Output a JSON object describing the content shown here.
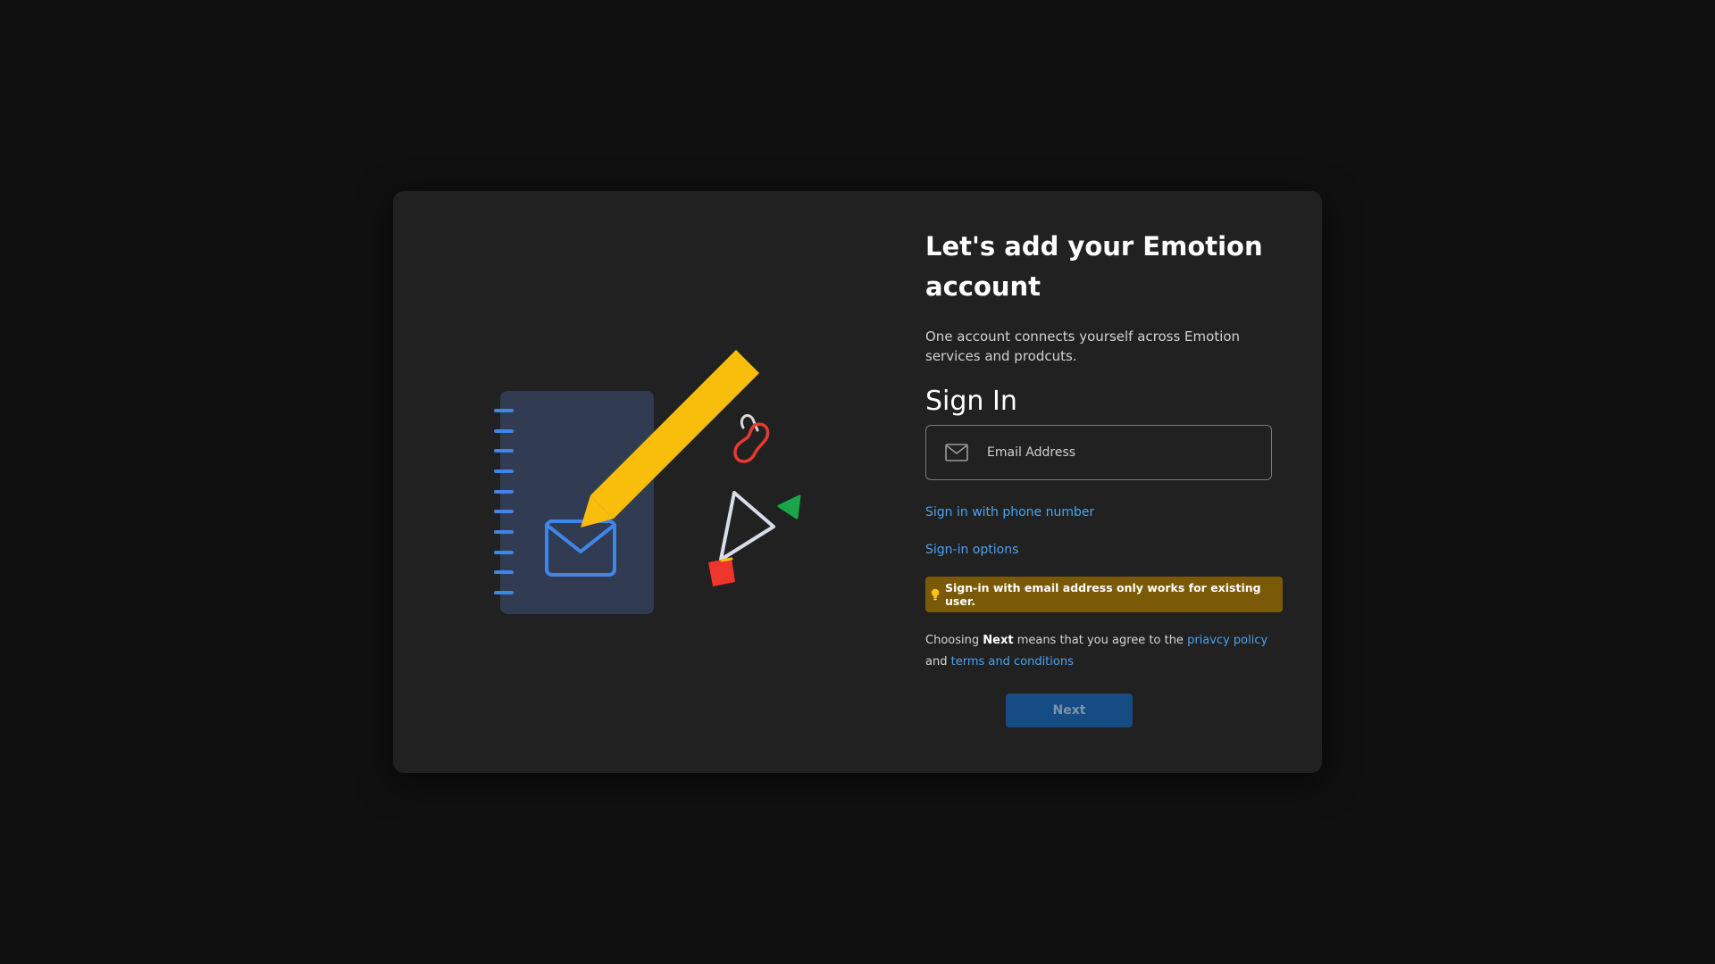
{
  "colors": {
    "background": "#101010",
    "dialog": "#212121",
    "link": "#4ba3f0",
    "notice_bg": "#7a5a06",
    "next_button_bg": "#164c84",
    "pencil": "#f9bd0b",
    "notebook": "#313b52",
    "envelope_line": "#3f86e8",
    "clip_red": "#e63a2f",
    "triangle_green": "#1aa548",
    "square_red": "#f0352c"
  },
  "header": {
    "title": "Let's add your Emotion account",
    "subtitle": "One account connects yourself across Emotion services and prodcuts."
  },
  "signin": {
    "heading": "Sign In",
    "email": {
      "icon": "envelope-icon",
      "placeholder": "Email Address",
      "value": ""
    },
    "phone_link": "Sign in with phone number",
    "options_link": "Sign-in options",
    "notice": {
      "icon": "lightbulb-icon",
      "text": "Sign-in with email address only works for existing user."
    },
    "terms": {
      "prefix": "Choosing",
      "next_word": "Next",
      "middle": "means that you agree to the",
      "privacy_link": "priavcy policy",
      "and": "and",
      "terms_link": "terms and conditions"
    },
    "next_button": "Next"
  },
  "illustration": {
    "icons": [
      "notebook-icon",
      "pencil-icon",
      "envelope-icon",
      "paperclip-icon",
      "triangle-outline-icon",
      "green-triangle-icon",
      "red-square-icon"
    ]
  }
}
